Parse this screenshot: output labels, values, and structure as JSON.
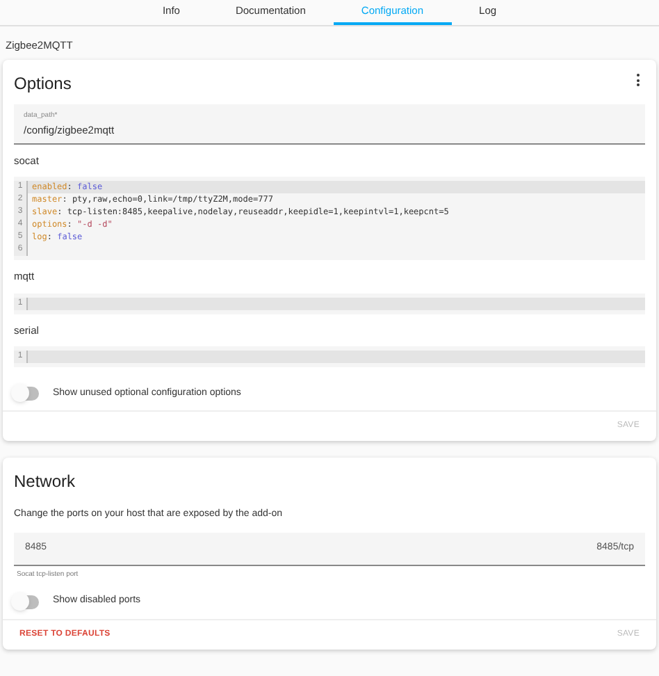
{
  "tabs": [
    {
      "label": "Info",
      "selected": false
    },
    {
      "label": "Documentation",
      "selected": false
    },
    {
      "label": "Configuration",
      "selected": true
    },
    {
      "label": "Log",
      "selected": false
    }
  ],
  "addon_name": "Zigbee2MQTT",
  "options": {
    "title": "Options",
    "data_path": {
      "label": "data_path*",
      "value": "/config/zigbee2mqtt"
    },
    "editors": [
      {
        "label": "socat",
        "lines": [
          {
            "number": "1",
            "key": "enabled",
            "colon": ":",
            "value": "false",
            "kind": "keyword",
            "active": true
          },
          {
            "number": "2",
            "key": "master",
            "colon": ":",
            "value": "pty,raw,echo=0,link=/tmp/ttyZ2M,mode=777",
            "kind": "plain",
            "active": false
          },
          {
            "number": "3",
            "key": "slave",
            "colon": ":",
            "value": "tcp-listen:8485,keepalive,nodelay,reuseaddr,keepidle=1,keepintvl=1,keepcnt=5",
            "kind": "plain",
            "active": false
          },
          {
            "number": "4",
            "key": "options",
            "colon": ":",
            "value": "\"-d -d\"",
            "kind": "string",
            "active": false
          },
          {
            "number": "5",
            "key": "log",
            "colon": ":",
            "value": "false",
            "kind": "keyword",
            "active": false
          },
          {
            "number": "6",
            "active": false
          }
        ]
      },
      {
        "label": "mqtt",
        "lines": [
          {
            "number": "1",
            "active": true
          }
        ]
      },
      {
        "label": "serial",
        "lines": [
          {
            "number": "1",
            "active": true
          }
        ]
      }
    ],
    "toggle": {
      "label": "Show unused optional configuration options",
      "on": false
    },
    "save": {
      "label": "SAVE",
      "disabled": true
    }
  },
  "network": {
    "title": "Network",
    "description": "Change the ports on your host that are exposed by the add-on",
    "port": {
      "value": "8485",
      "suffix": "8485/tcp",
      "helper": "Socat tcp-listen port"
    },
    "toggle": {
      "label": "Show disabled ports",
      "on": false
    },
    "reset": {
      "label": "RESET TO DEFAULTS"
    },
    "save": {
      "label": "SAVE",
      "disabled": true
    }
  }
}
